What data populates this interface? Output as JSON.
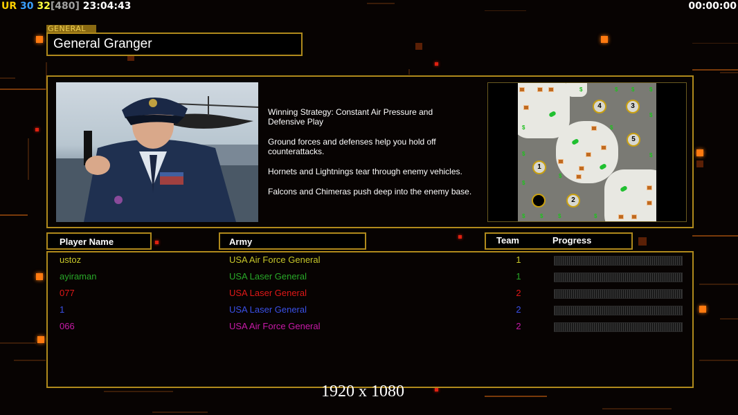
{
  "hud": {
    "ur_label": "UR",
    "value_a": "30",
    "value_b": "32",
    "value_c": "[480]",
    "clock": "23:04:43",
    "timer": "00:00:00"
  },
  "general": {
    "tag": "GENERAL",
    "name": "General Granger",
    "strategy": [
      "Winning Strategy: Constant Air Pressure and\n Defensive Play",
      "Ground forces and defenses help you hold off\n counterattacks.",
      "Hornets and Lightnings tear through enemy vehicles.",
      "Falcons and Chimeras push deep into the enemy base."
    ]
  },
  "minimap": {
    "starts": [
      "1",
      "2",
      "3",
      "4",
      "5"
    ]
  },
  "table": {
    "headers": {
      "player": "Player Name",
      "army": "Army",
      "team": "Team",
      "progress": "Progress"
    },
    "rows": [
      {
        "name": "ustoz",
        "army": "USA Air Force General",
        "team": "1",
        "color": "#c8c82a"
      },
      {
        "name": "ayiraman",
        "army": "USA Laser General",
        "team": "1",
        "color": "#28a828"
      },
      {
        "name": "077",
        "army": "USA Laser General",
        "team": "2",
        "color": "#e01818"
      },
      {
        "name": "1",
        "army": "USA Laser General",
        "team": "2",
        "color": "#3a50e8"
      },
      {
        "name": "066",
        "army": "USA Air Force General",
        "team": "2",
        "color": "#c81aa8"
      }
    ]
  },
  "footer": {
    "resolution": "1920 x 1080"
  },
  "colors": {
    "accent": "#b08a1c",
    "hud_ur": "#ffd000",
    "hud_a": "#3aa0ff",
    "hud_b": "#ffff40",
    "hud_c": "#a0a0a0"
  }
}
